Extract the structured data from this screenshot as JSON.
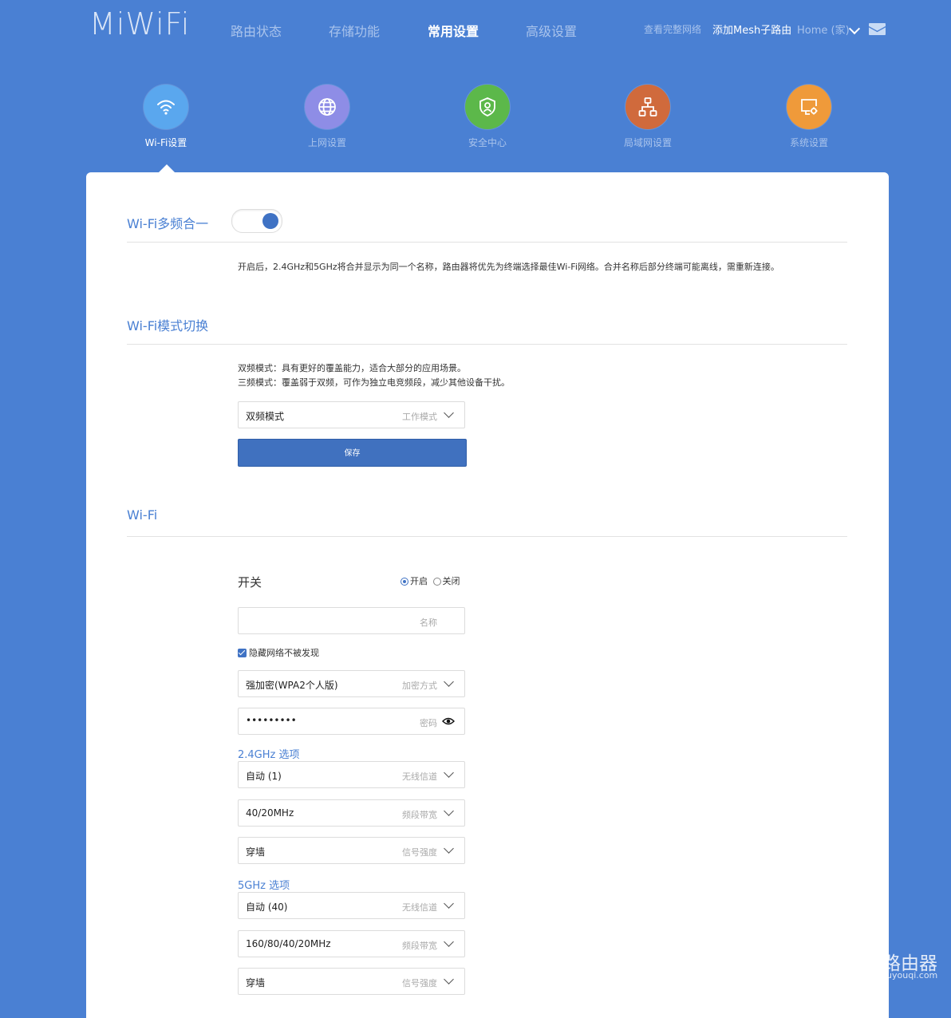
{
  "header": {
    "logo": "MiWiFi",
    "nav": [
      "路由状态",
      "存储功能",
      "常用设置",
      "高级设置"
    ],
    "active_nav": "常用设置",
    "links": {
      "view_network": "查看完整网络",
      "add_mesh": "添加Mesh子路由",
      "home": "Home (家)"
    }
  },
  "categories": [
    {
      "label": "Wi-Fi设置",
      "icon": "wifi-icon",
      "color": "#5aa7ee"
    },
    {
      "label": "上网设置",
      "icon": "globe-icon",
      "color": "#8e8de6"
    },
    {
      "label": "安全中心",
      "icon": "shield-icon",
      "color": "#5cb84a"
    },
    {
      "label": "局域网设置",
      "icon": "network-icon",
      "color": "#d06a3c"
    },
    {
      "label": "系统设置",
      "icon": "system-settings-icon",
      "color": "#ef9a3a"
    }
  ],
  "multiband": {
    "title": "Wi-Fi多频合一",
    "enabled": true,
    "description": "开启后，2.4GHz和5GHz将合并显示为同一个名称，路由器将优先为终端选择最佳Wi-Fi网络。合并名称后部分终端可能离线，需重新连接。"
  },
  "mode": {
    "title": "Wi-Fi模式切换",
    "desc_line1": "双频模式：具有更好的覆盖能力，适合大部分的应用场景。",
    "desc_line2": "三频模式：覆盖弱于双频，可作为独立电竞频段，减少其他设备干扰。",
    "select_value": "双频模式",
    "select_label": "工作模式",
    "save_label": "保存"
  },
  "wifi": {
    "title": "Wi-Fi",
    "switch_label": "开关",
    "radio_on": "开启",
    "radio_off": "关闭",
    "name_placeholder": "名称",
    "name_value": "",
    "hide_label": "隐藏网络不被发现",
    "hide_checked": true,
    "encryption_value": "强加密(WPA2个人版)",
    "encryption_label": "加密方式",
    "password_value": "•••••••••",
    "password_label": "密码",
    "band24": {
      "title": "2.4GHz 选项",
      "channel_value": "自动 (1)",
      "channel_label": "无线信道",
      "bandwidth_value": "40/20MHz",
      "bandwidth_label": "频段带宽",
      "signal_value": "穿墙",
      "signal_label": "信号强度"
    },
    "band5": {
      "title": "5GHz 选项",
      "channel_value": "自动 (40)",
      "channel_label": "无线信道",
      "bandwidth_value": "160/80/40/20MHz",
      "bandwidth_label": "频段带宽",
      "signal_value": "穿墙",
      "signal_label": "信号强度"
    }
  },
  "watermark": {
    "main": "路由器",
    "sub": "luyouqi.com"
  }
}
